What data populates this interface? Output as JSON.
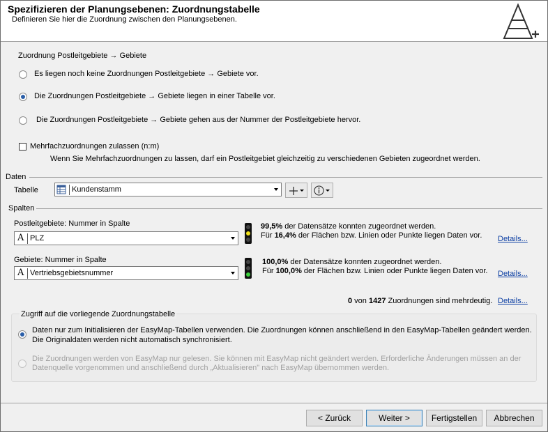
{
  "header": {
    "title": "Spezifizieren der Planungsebenen: Zuordnungstabelle",
    "subtitle": "Definieren Sie hier die Zuordnung zwischen den Planungsebenen."
  },
  "assignment": {
    "heading": "Zuordnung Postleitgebiete → Gebiete",
    "options": [
      {
        "label": "Es liegen noch keine Zuordnungen Postleitgebiete → Gebiete vor.",
        "selected": false
      },
      {
        "label": "Die Zuordnungen Postleitgebiete → Gebiete liegen in einer Tabelle vor.",
        "selected": true
      },
      {
        "label": "Die Zuordnungen Postleitgebiete → Gebiete gehen aus der Nummer der Postleitgebiete hervor.",
        "selected": false
      }
    ],
    "multi_label": "Mehrfachzuordnungen zulassen (n:m)",
    "multi_checked": false,
    "multi_hint": "Wenn Sie Mehrfachzuordnungen zu lassen, darf ein Postleitgebiet gleichzeitig zu verschiedenen Gebieten zugeordnet werden."
  },
  "daten": {
    "section_label": "Daten",
    "table_label": "Tabelle",
    "table_value": "Kundenstamm"
  },
  "spalten": {
    "section_label": "Spalten",
    "plz": {
      "label": "Postleitgebiete: Nummer in Spalte",
      "value": "PLZ",
      "status_color": "yellow",
      "pct1": "99,5%",
      "text1": " der Datensätze konnten zugeordnet werden.",
      "text2a": "Für ",
      "pct2": "16,4%",
      "text2b": " der Flächen bzw. Linien oder Punkte liegen Daten vor.",
      "details": "Details..."
    },
    "gebiete": {
      "label": "Gebiete: Nummer in Spalte",
      "value": "Vertriebsgebietsnummer",
      "status_color": "green",
      "pct1": "100,0%",
      "text1": " der Datensätze konnten zugeordnet werden.",
      "text2a": "Für ",
      "pct2": "100,0%",
      "text2b": " der Flächen bzw. Linien oder Punkte liegen Daten vor.",
      "details": "Details..."
    },
    "summary": {
      "count": "0",
      "mid": " von ",
      "total": "1427",
      "text": " Zuordnungen sind mehrdeutig.",
      "details": "Details..."
    }
  },
  "zugriff": {
    "label": "Zugriff auf die vorliegende Zuordnungstabelle",
    "option1_line1": "Daten nur zum Initialisieren der EasyMap-Tabellen verwenden. Die Zuordnungen können anschließend in den EasyMap-Tabellen geändert werden.",
    "option1_line2": "Die Originaldaten werden nicht automatisch synchronisiert.",
    "option1_selected": true,
    "option2_line1": "Die Zuordnungen werden von EasyMap nur gelesen. Sie können mit EasyMap nicht geändert werden. Erforderliche Änderungen müssen an der",
    "option2_line2": "Datenquelle vorgenommen und anschließend durch „Aktualisieren\" nach EasyMap übernommen werden.",
    "option2_selected": false
  },
  "buttons": {
    "back": "< Zurück",
    "next": "Weiter >",
    "finish": "Fertigstellen",
    "cancel": "Abbrechen"
  }
}
